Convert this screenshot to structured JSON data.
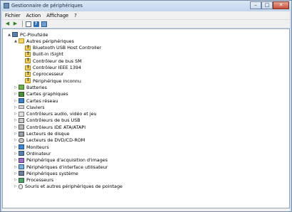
{
  "window": {
    "title": "Gestionnaire de périphériques"
  },
  "caption": {
    "minimize_icon": "minimize-icon",
    "maximize_icon": "maximize-icon",
    "close_icon": "close-icon"
  },
  "menubar": {
    "items": [
      "Fichier",
      "Action",
      "Affichage",
      "?"
    ]
  },
  "toolbar": {
    "icons": [
      "back-arrow-icon",
      "forward-arrow-icon",
      "properties-icon",
      "help-icon",
      "device-icon"
    ]
  },
  "tree": {
    "root": {
      "label": "PC-Ploufside",
      "expanded": true
    },
    "categories": [
      {
        "label": "Autres périphériques",
        "expanded": true,
        "icon": "folder-icon",
        "children": [
          {
            "label": "Bluetooth USB Host Controller",
            "icon": "warning-device-icon"
          },
          {
            "label": "Built-in iSight",
            "icon": "warning-device-icon"
          },
          {
            "label": "Contrôleur de bus SM",
            "icon": "warning-device-icon"
          },
          {
            "label": "Contrôleur IEEE 1394",
            "icon": "warning-device-icon"
          },
          {
            "label": "Coprocesseur",
            "icon": "warning-device-icon"
          },
          {
            "label": "Périphérique inconnu",
            "icon": "warning-device-icon"
          }
        ]
      },
      {
        "label": "Batteries",
        "icon": "battery-icon"
      },
      {
        "label": "Cartes graphiques",
        "icon": "display-adapter-icon"
      },
      {
        "label": "Cartes réseau",
        "icon": "network-adapter-icon"
      },
      {
        "label": "Claviers",
        "icon": "keyboard-icon"
      },
      {
        "label": "Contrôleurs audio, vidéo et jeu",
        "icon": "audio-icon"
      },
      {
        "label": "Contrôleurs de bus USB",
        "icon": "usb-icon"
      },
      {
        "label": "Contrôleurs IDE ATA/ATAPI",
        "icon": "ide-icon"
      },
      {
        "label": "Lecteurs de disque",
        "icon": "disk-drive-icon"
      },
      {
        "label": "Lecteurs de DVD/CD-ROM",
        "icon": "dvd-icon"
      },
      {
        "label": "Moniteurs",
        "icon": "monitor-icon"
      },
      {
        "label": "Ordinateur",
        "icon": "computer-icon"
      },
      {
        "label": "Périphérique d'acquisition d'images",
        "icon": "imaging-device-icon"
      },
      {
        "label": "Périphériques d'interface utilisateur",
        "icon": "hid-icon"
      },
      {
        "label": "Périphériques système",
        "icon": "system-device-icon"
      },
      {
        "label": "Processeurs",
        "icon": "processor-icon"
      },
      {
        "label": "Souris et autres périphériques de pointage",
        "icon": "mouse-icon"
      }
    ]
  }
}
